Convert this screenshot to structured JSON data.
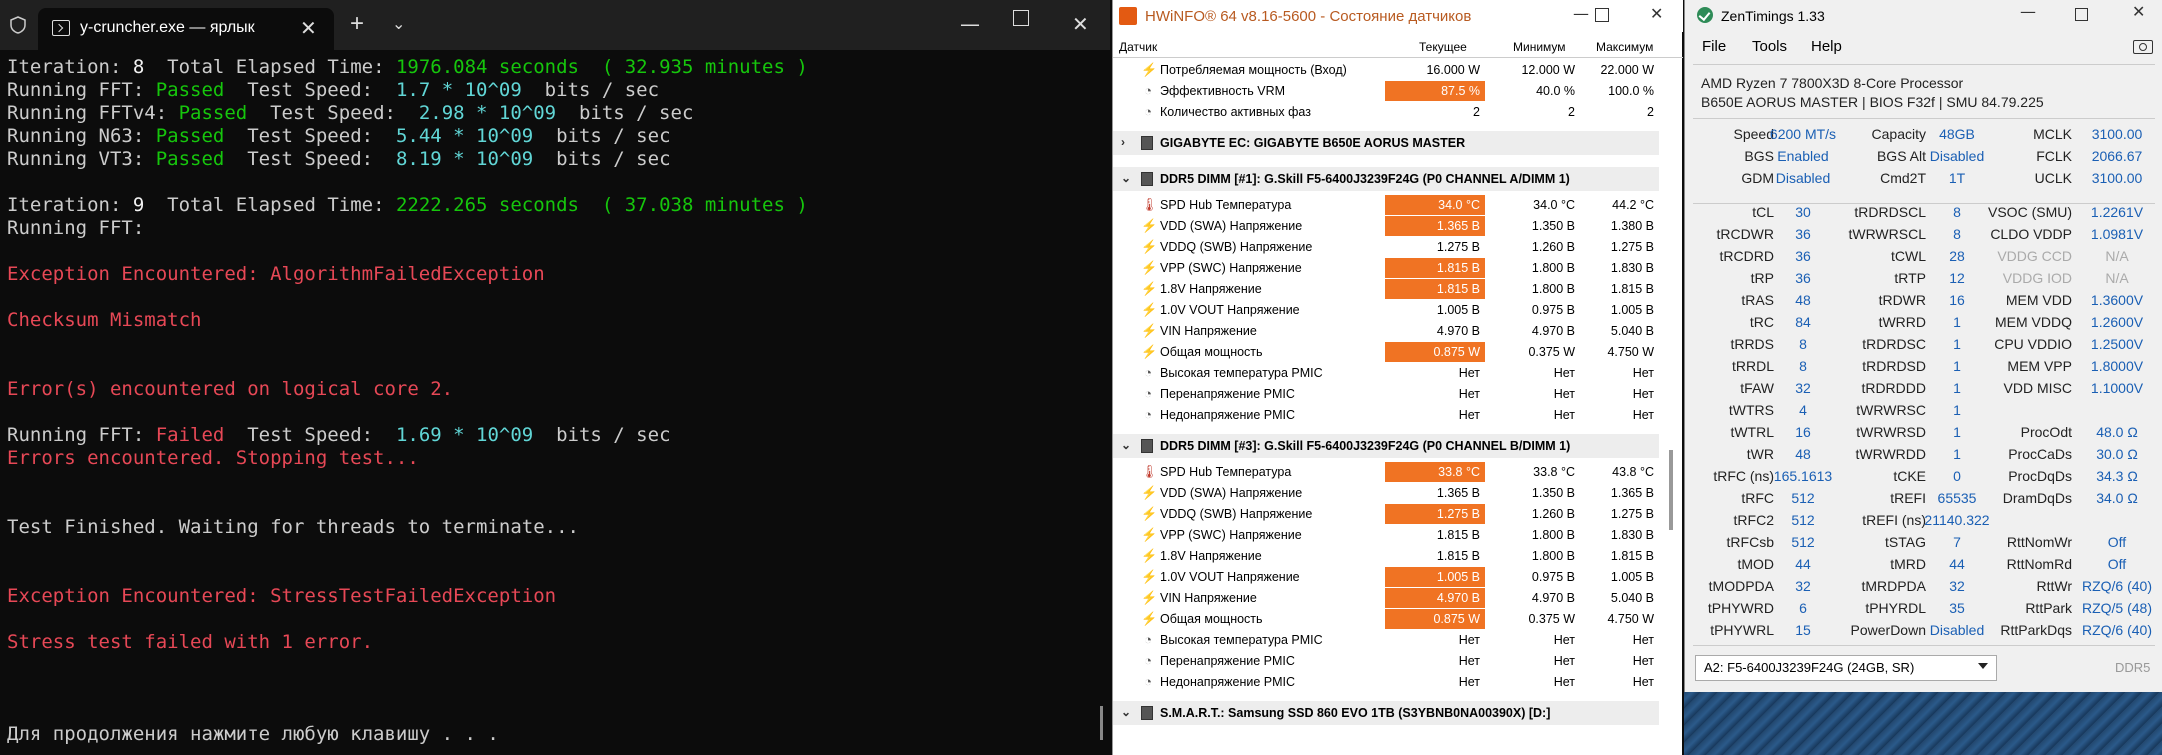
{
  "terminal": {
    "tab_title": "y-cruncher.exe — ярлык",
    "lines": [
      [
        [
          "c-w",
          "Iteration: "
        ],
        [
          "c-bw",
          "8"
        ],
        [
          "c-w",
          "  Total Elapsed Time: "
        ],
        [
          "c-g",
          "1976.084 seconds  ( 32.935 minutes )"
        ]
      ],
      [
        [
          "c-w",
          "Running FFT: "
        ],
        [
          "c-g",
          "Passed"
        ],
        [
          "c-w",
          "  Test Speed:  "
        ],
        [
          "c-b",
          "1.7 * 10^09"
        ],
        [
          "c-w",
          "  bits / sec"
        ]
      ],
      [
        [
          "c-w",
          "Running FFTv4: "
        ],
        [
          "c-g",
          "Passed"
        ],
        [
          "c-w",
          "  Test Speed:  "
        ],
        [
          "c-b",
          "2.98 * 10^09"
        ],
        [
          "c-w",
          "  bits / sec"
        ]
      ],
      [
        [
          "c-w",
          "Running N63: "
        ],
        [
          "c-g",
          "Passed"
        ],
        [
          "c-w",
          "  Test Speed:  "
        ],
        [
          "c-b",
          "5.44 * 10^09"
        ],
        [
          "c-w",
          "  bits / sec"
        ]
      ],
      [
        [
          "c-w",
          "Running VT3: "
        ],
        [
          "c-g",
          "Passed"
        ],
        [
          "c-w",
          "  Test Speed:  "
        ],
        [
          "c-b",
          "8.19 * 10^09"
        ],
        [
          "c-w",
          "  bits / sec"
        ]
      ],
      [],
      [
        [
          "c-w",
          "Iteration: "
        ],
        [
          "c-bw",
          "9"
        ],
        [
          "c-w",
          "  Total Elapsed Time: "
        ],
        [
          "c-g",
          "2222.265 seconds  ( 37.038 minutes )"
        ]
      ],
      [
        [
          "c-w",
          "Running FFT:"
        ]
      ],
      [],
      [
        [
          "c-r",
          "Exception Encountered: AlgorithmFailedException"
        ]
      ],
      [],
      [
        [
          "c-r",
          "Checksum Mismatch"
        ]
      ],
      [],
      [],
      [
        [
          "c-r",
          "Error(s) encountered on logical core 2."
        ]
      ],
      [],
      [
        [
          "c-w",
          "Running FFT: "
        ],
        [
          "c-r",
          "Failed"
        ],
        [
          "c-w",
          "  Test Speed:  "
        ],
        [
          "c-b",
          "1.69 * 10^09"
        ],
        [
          "c-w",
          "  bits / sec"
        ]
      ],
      [
        [
          "c-r",
          "Errors encountered. Stopping test..."
        ]
      ],
      [],
      [],
      [
        [
          "c-w",
          "Test Finished. Waiting for threads to terminate..."
        ]
      ],
      [],
      [],
      [
        [
          "c-r",
          "Exception Encountered: StressTestFailedException"
        ]
      ],
      [],
      [
        [
          "c-r",
          "Stress test failed with 1 error."
        ]
      ],
      [],
      [],
      [],
      [
        [
          "c-w",
          "Для продолжения нажмите любую клавишу . . ."
        ]
      ]
    ]
  },
  "hwinfo": {
    "title": "HWiNFO® 64 v8.16-5600 - Состояние датчиков",
    "columns": [
      "Датчик",
      "Текущее",
      "Минимум",
      "Максимум"
    ],
    "rows": [
      {
        "kind": "row",
        "icon": "bolt",
        "name": "Потребляемая мощность (Вход)",
        "v": [
          "16.000 W",
          "12.000 W",
          "22.000 W"
        ],
        "hl": false
      },
      {
        "kind": "row",
        "icon": "gauge",
        "name": "Эффективность VRM",
        "v": [
          "87.5 %",
          "40.0 %",
          "100.0 %"
        ],
        "hl": true
      },
      {
        "kind": "row",
        "icon": "gauge",
        "name": "Количество активных фаз",
        "v": [
          "2",
          "2",
          "2"
        ],
        "hl": false
      },
      {
        "kind": "gap"
      },
      {
        "kind": "sec",
        "chev": "›",
        "name": "GIGABYTE EC: GIGABYTE B650E AORUS MASTER"
      },
      {
        "kind": "gap"
      },
      {
        "kind": "sec",
        "chev": "⌄",
        "name": "DDR5 DIMM [#1]: G.Skill F5-6400J3239F24G (P0 CHANNEL A/DIMM 1)"
      },
      {
        "kind": "row",
        "icon": "therm",
        "name": "SPD Hub Температура",
        "v": [
          "34.0 °C",
          "34.0 °C",
          "44.2 °C"
        ],
        "hl": true
      },
      {
        "kind": "row",
        "icon": "bolt",
        "name": "VDD (SWA) Напряжение",
        "v": [
          "1.365 В",
          "1.350 В",
          "1.380 В"
        ],
        "hl": true
      },
      {
        "kind": "row",
        "icon": "bolt",
        "name": "VDDQ (SWB) Напряжение",
        "v": [
          "1.275 В",
          "1.260 В",
          "1.275 В"
        ],
        "hl": false
      },
      {
        "kind": "row",
        "icon": "bolt",
        "name": "VPP (SWC) Напряжение",
        "v": [
          "1.815 В",
          "1.800 В",
          "1.830 В"
        ],
        "hl": true
      },
      {
        "kind": "row",
        "icon": "bolt",
        "name": "1.8V Напряжение",
        "v": [
          "1.815 В",
          "1.800 В",
          "1.815 В"
        ],
        "hl": true
      },
      {
        "kind": "row",
        "icon": "bolt",
        "name": "1.0V VOUT Напряжение",
        "v": [
          "1.005 В",
          "0.975 В",
          "1.005 В"
        ],
        "hl": false
      },
      {
        "kind": "row",
        "icon": "bolt",
        "name": "VIN Напряжение",
        "v": [
          "4.970 В",
          "4.970 В",
          "5.040 В"
        ],
        "hl": false
      },
      {
        "kind": "row",
        "icon": "bolt",
        "name": "Общая мощность",
        "v": [
          "0.875 W",
          "0.375 W",
          "4.750 W"
        ],
        "hl": true
      },
      {
        "kind": "row",
        "icon": "gauge",
        "name": "Высокая температура PMIC",
        "v": [
          "Нет",
          "Нет",
          "Нет"
        ],
        "hl": false
      },
      {
        "kind": "row",
        "icon": "gauge",
        "name": "Перенапряжение PMIC",
        "v": [
          "Нет",
          "Нет",
          "Нет"
        ],
        "hl": false
      },
      {
        "kind": "row",
        "icon": "gauge",
        "name": "Недонапряжение PMIC",
        "v": [
          "Нет",
          "Нет",
          "Нет"
        ],
        "hl": false
      },
      {
        "kind": "gap"
      },
      {
        "kind": "sec",
        "chev": "⌄",
        "name": "DDR5 DIMM [#3]: G.Skill F5-6400J3239F24G (P0 CHANNEL B/DIMM 1)"
      },
      {
        "kind": "row",
        "icon": "therm",
        "name": "SPD Hub Температура",
        "v": [
          "33.8 °C",
          "33.8 °C",
          "43.8 °C"
        ],
        "hl": true
      },
      {
        "kind": "row",
        "icon": "bolt",
        "name": "VDD (SWA) Напряжение",
        "v": [
          "1.365 В",
          "1.350 В",
          "1.365 В"
        ],
        "hl": false
      },
      {
        "kind": "row",
        "icon": "bolt",
        "name": "VDDQ (SWB) Напряжение",
        "v": [
          "1.275 В",
          "1.260 В",
          "1.275 В"
        ],
        "hl": true
      },
      {
        "kind": "row",
        "icon": "bolt",
        "name": "VPP (SWC) Напряжение",
        "v": [
          "1.815 В",
          "1.800 В",
          "1.830 В"
        ],
        "hl": false
      },
      {
        "kind": "row",
        "icon": "bolt",
        "name": "1.8V Напряжение",
        "v": [
          "1.815 В",
          "1.800 В",
          "1.815 В"
        ],
        "hl": false
      },
      {
        "kind": "row",
        "icon": "bolt",
        "name": "1.0V VOUT Напряжение",
        "v": [
          "1.005 В",
          "0.975 В",
          "1.005 В"
        ],
        "hl": true
      },
      {
        "kind": "row",
        "icon": "bolt",
        "name": "VIN Напряжение",
        "v": [
          "4.970 В",
          "4.970 В",
          "5.040 В"
        ],
        "hl": true
      },
      {
        "kind": "row",
        "icon": "bolt",
        "name": "Общая мощность",
        "v": [
          "0.875 W",
          "0.375 W",
          "4.750 W"
        ],
        "hl": true
      },
      {
        "kind": "row",
        "icon": "gauge",
        "name": "Высокая температура PMIC",
        "v": [
          "Нет",
          "Нет",
          "Нет"
        ],
        "hl": false
      },
      {
        "kind": "row",
        "icon": "gauge",
        "name": "Перенапряжение PMIC",
        "v": [
          "Нет",
          "Нет",
          "Нет"
        ],
        "hl": false
      },
      {
        "kind": "row",
        "icon": "gauge",
        "name": "Недонапряжение PMIC",
        "v": [
          "Нет",
          "Нет",
          "Нет"
        ],
        "hl": false
      },
      {
        "kind": "gap"
      },
      {
        "kind": "sec",
        "chev": "⌄",
        "name": "S.M.A.R.T.: Samsung SSD 860 EVO 1TB (S3YBNB0NA00390X) [D:]"
      }
    ]
  },
  "zentimings": {
    "title": "ZenTimings 1.33",
    "menu": [
      "File",
      "Tools",
      "Help"
    ],
    "cpu": "AMD Ryzen 7 7800X3D 8-Core Processor",
    "board": "B650E AORUS MASTER | BIOS F32f | SMU 84.79.225",
    "top": [
      [
        [
          "Speed",
          "6200 MT/s"
        ],
        [
          "Capacity",
          "48GB"
        ],
        [
          "MCLK",
          "3100.00"
        ]
      ],
      [
        [
          "BGS",
          "Enabled"
        ],
        [
          "BGS Alt",
          "Disabled"
        ],
        [
          "FCLK",
          "2066.67"
        ]
      ],
      [
        [
          "GDM",
          "Disabled"
        ],
        [
          "Cmd2T",
          "1T"
        ],
        [
          "UCLK",
          "3100.00"
        ]
      ]
    ],
    "timings": [
      [
        [
          "tCL",
          "30"
        ],
        [
          "tRDRDSCL",
          "8"
        ],
        [
          "VSOC (SMU)",
          "1.2261V"
        ]
      ],
      [
        [
          "tRCDWR",
          "36"
        ],
        [
          "tWRWRSCL",
          "8"
        ],
        [
          "CLDO VDDP",
          "1.0981V"
        ]
      ],
      [
        [
          "tRCDRD",
          "36"
        ],
        [
          "tCWL",
          "28"
        ],
        [
          "VDDG CCD",
          "N/A"
        ]
      ],
      [
        [
          "tRP",
          "36"
        ],
        [
          "tRTP",
          "12"
        ],
        [
          "VDDG IOD",
          "N/A"
        ]
      ],
      [
        [
          "tRAS",
          "48"
        ],
        [
          "tRDWR",
          "16"
        ],
        [
          "MEM VDD",
          "1.3600V"
        ]
      ],
      [
        [
          "tRC",
          "84"
        ],
        [
          "tWRRD",
          "1"
        ],
        [
          "MEM VDDQ",
          "1.2600V"
        ]
      ],
      [
        [
          "tRRDS",
          "8"
        ],
        [
          "tRDRDSC",
          "1"
        ],
        [
          "CPU VDDIO",
          "1.2500V"
        ]
      ],
      [
        [
          "tRRDL",
          "8"
        ],
        [
          "tRDRDSD",
          "1"
        ],
        [
          "MEM VPP",
          "1.8000V"
        ]
      ],
      [
        [
          "tFAW",
          "32"
        ],
        [
          "tRDRDDD",
          "1"
        ],
        [
          "VDD MISC",
          "1.1000V"
        ]
      ],
      [
        [
          "tWTRS",
          "4"
        ],
        [
          "tWRWRSC",
          "1"
        ],
        [
          "",
          ""
        ]
      ],
      [
        [
          "tWTRL",
          "16"
        ],
        [
          "tWRWRSD",
          "1"
        ],
        [
          "ProcOdt",
          "48.0 Ω"
        ]
      ],
      [
        [
          "tWR",
          "48"
        ],
        [
          "tWRWRDD",
          "1"
        ],
        [
          "ProcCaDs",
          "30.0 Ω"
        ]
      ],
      [
        [
          "tRFC (ns)",
          "165.1613"
        ],
        [
          "tCKE",
          "0"
        ],
        [
          "ProcDqDs",
          "34.3 Ω"
        ]
      ],
      [
        [
          "tRFC",
          "512"
        ],
        [
          "tREFI",
          "65535"
        ],
        [
          "DramDqDs",
          "34.0 Ω"
        ]
      ],
      [
        [
          "tRFC2",
          "512"
        ],
        [
          "tREFI (ns)",
          "21140.322"
        ],
        [
          "",
          ""
        ]
      ],
      [
        [
          "tRFCsb",
          "512"
        ],
        [
          "tSTAG",
          "7"
        ],
        [
          "RttNomWr",
          "Off"
        ]
      ],
      [
        [
          "tMOD",
          "44"
        ],
        [
          "tMRD",
          "44"
        ],
        [
          "RttNomRd",
          "Off"
        ]
      ],
      [
        [
          "tMODPDA",
          "32"
        ],
        [
          "tMRDPDA",
          "32"
        ],
        [
          "RttWr",
          "RZQ/6 (40)"
        ]
      ],
      [
        [
          "tPHYWRD",
          "6"
        ],
        [
          "tPHYRDL",
          "35"
        ],
        [
          "RttPark",
          "RZQ/5 (48)"
        ]
      ],
      [
        [
          "tPHYWRL",
          "15"
        ],
        [
          "PowerDown",
          "Disabled"
        ],
        [
          "RttParkDqs",
          "RZQ/6 (40)"
        ]
      ]
    ],
    "module_select": "A2: F5-6400J3239F24G (24GB, SR)",
    "ddr_label": "DDR5"
  },
  "colors": {
    "accent_hwinfo": "#f07323",
    "zen_value": "#1a5fb4",
    "term_green": "#16c60c",
    "term_red": "#e74856",
    "term_cyan": "#61d6d6"
  }
}
